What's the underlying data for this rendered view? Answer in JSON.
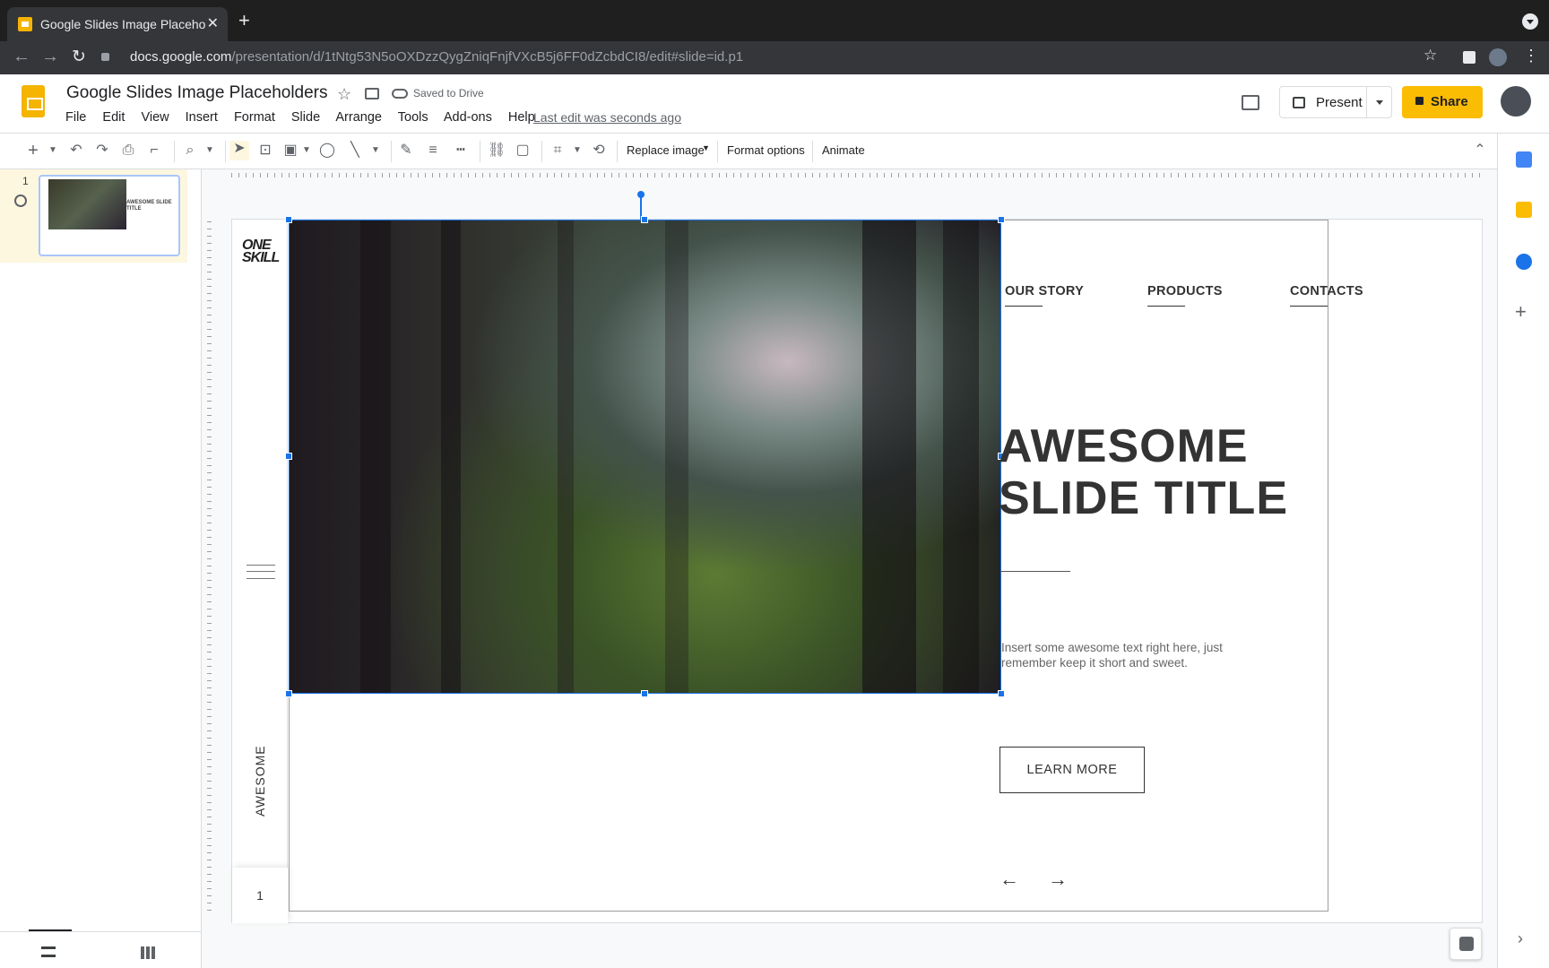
{
  "browser": {
    "tab_title": "Google Slides Image Placehold",
    "url_host": "docs.google.com",
    "url_path": "/presentation/d/1tNtg53N5oOXDzzQygZniqFnjfVXcB5j6FF0dZcbdCI8/edit#slide=id.p1"
  },
  "app": {
    "doc_title": "Google Slides Image Placeholders",
    "saved_status": "Saved to Drive",
    "menus": [
      "File",
      "Edit",
      "View",
      "Insert",
      "Format",
      "Slide",
      "Arrange",
      "Tools",
      "Add-ons",
      "Help"
    ],
    "last_edit": "Last edit was seconds ago",
    "present_label": "Present",
    "share_label": "Share",
    "brand_color": "#fbbc04",
    "selection_color": "#1a73e8"
  },
  "toolbar": {
    "replace_image": "Replace image",
    "format_options": "Format options",
    "animate": "Animate"
  },
  "filmstrip": {
    "slide_number": "1",
    "thumb_title": "AWESOME SLIDE TITLE"
  },
  "slide": {
    "logo_line1": "ONE",
    "logo_line2": "SKILL",
    "vertical_label": "AWESOME",
    "page_number": "1",
    "nav": [
      "OUR STORY",
      "PRODUCTS",
      "CONTACTS"
    ],
    "title_line1": "AWESOME",
    "title_line2": "SLIDE TITLE",
    "body_text": "Insert some awesome text right here, just remember keep it short and sweet.",
    "button_label": "LEARN MORE",
    "arrow_prev": "←",
    "arrow_next": "→"
  }
}
